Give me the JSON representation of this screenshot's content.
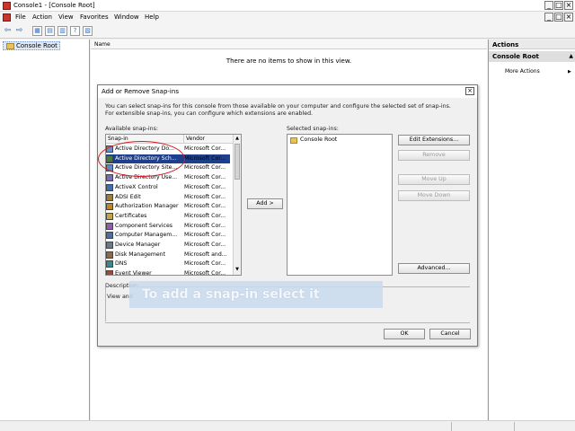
{
  "window": {
    "title": "Console1 - [Console Root]",
    "min": "_",
    "max": "□",
    "close": "×"
  },
  "menubar": [
    {
      "name": "menu-file",
      "label": "File"
    },
    {
      "name": "menu-action",
      "label": "Action"
    },
    {
      "name": "menu-view",
      "label": "View"
    },
    {
      "name": "menu-favorites",
      "label": "Favorites"
    },
    {
      "name": "menu-window",
      "label": "Window"
    },
    {
      "name": "menu-help",
      "label": "Help"
    }
  ],
  "tree": {
    "root": "Console Root"
  },
  "center": {
    "column": "Name",
    "empty_message": "There are no items to show in this view."
  },
  "actions": {
    "header": "Actions",
    "section": "Console Root",
    "more": "More Actions"
  },
  "dialog": {
    "title": "Add or Remove Snap-ins",
    "close": "×",
    "description": "You can select snap-ins for this console from those available on your computer and configure the selected set of snap-ins. For extensible snap-ins, you can configure which extensions are enabled.",
    "available_label": "Available snap-ins:",
    "columns": {
      "snapin": "Snap-in",
      "vendor": "Vendor"
    },
    "available": [
      {
        "name": "Active Directory Do...",
        "vendor": "Microsoft Cor...",
        "icon": "ad-domains-icon"
      },
      {
        "name": "Active Directory Sch...",
        "vendor": "Microsoft Cor...",
        "icon": "ad-schema-icon"
      },
      {
        "name": "Active Directory Site...",
        "vendor": "Microsoft Cor...",
        "icon": "ad-sites-icon"
      },
      {
        "name": "Active Directory Use...",
        "vendor": "Microsoft Cor...",
        "icon": "ad-users-icon"
      },
      {
        "name": "ActiveX Control",
        "vendor": "Microsoft Cor...",
        "icon": "activex-icon"
      },
      {
        "name": "ADSI Edit",
        "vendor": "Microsoft Cor...",
        "icon": "adsi-edit-icon"
      },
      {
        "name": "Authorization Manager",
        "vendor": "Microsoft Cor...",
        "icon": "authorization-icon"
      },
      {
        "name": "Certificates",
        "vendor": "Microsoft Cor...",
        "icon": "certificate-icon"
      },
      {
        "name": "Component Services",
        "vendor": "Microsoft Cor...",
        "icon": "component-icon"
      },
      {
        "name": "Computer Managem...",
        "vendor": "Microsoft Cor...",
        "icon": "computer-icon"
      },
      {
        "name": "Device Manager",
        "vendor": "Microsoft Cor...",
        "icon": "device-icon"
      },
      {
        "name": "Disk Management",
        "vendor": "Microsoft and...",
        "icon": "disk-icon"
      },
      {
        "name": "DNS",
        "vendor": "Microsoft Cor...",
        "icon": "dns-icon"
      },
      {
        "name": "Event Viewer",
        "vendor": "Microsoft Cor...",
        "icon": "event-icon"
      }
    ],
    "selected_index": 1,
    "add_button": "Add >",
    "selected_label": "Selected snap-ins:",
    "selected": [
      "Console Root"
    ],
    "side_buttons": [
      "Edit Extensions...",
      "Remove",
      "Move Up",
      "Move Down"
    ],
    "advanced": "Advanced...",
    "description_label": "Description:",
    "description_text": "View and",
    "ok": "OK",
    "cancel": "Cancel"
  },
  "overlay": {
    "text": "To add a snap-in select it"
  },
  "colors": {
    "selection": "#1e3f8c",
    "annotation": "#d01f24",
    "overlay": "#c8daee"
  }
}
